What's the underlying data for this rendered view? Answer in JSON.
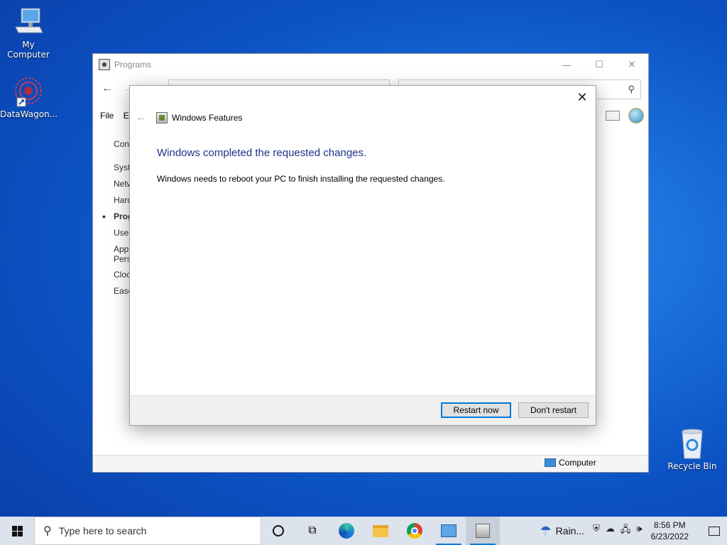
{
  "desktop": {
    "icons": [
      {
        "label": "My Computer",
        "icon": "computer-icon"
      },
      {
        "label": "DataWagon...",
        "icon": "datawagon-icon"
      },
      {
        "label": "Recycle Bin",
        "icon": "recycle-bin-icon"
      }
    ]
  },
  "explorer": {
    "title": "Programs",
    "controls": {
      "minimize": "—",
      "maximize": "☐",
      "close": "✕"
    },
    "menu": [
      "File",
      "Ec"
    ],
    "sidebar": [
      "Cont",
      "Syste",
      "Netw",
      "Hard",
      "Prog",
      "User",
      "App",
      "Pers",
      "Clock",
      "Ease"
    ],
    "sidebar_current": "Prog",
    "status_computer": "Computer"
  },
  "dialog": {
    "header": "Windows Features",
    "title": "Windows completed the requested changes.",
    "message": "Windows needs to reboot your PC to finish installing the requested changes.",
    "buttons": {
      "restart": "Restart now",
      "dont": "Don't restart"
    },
    "close": "✕"
  },
  "taskbar": {
    "search_placeholder": "Type here to search",
    "weather": "Rain...",
    "time": "8:56 PM",
    "date": "6/23/2022",
    "accent": "#0078d7"
  }
}
